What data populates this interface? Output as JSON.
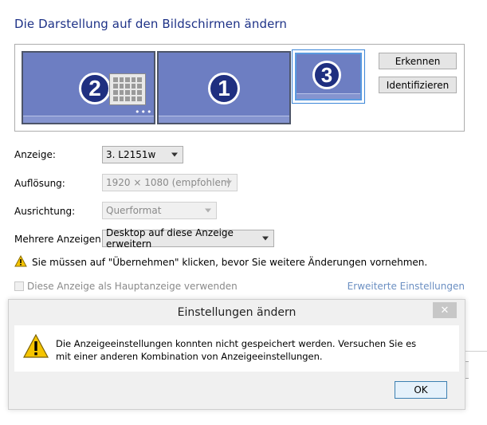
{
  "page": {
    "title": "Die Darstellung auf den Bildschirmen ändern"
  },
  "monitors": [
    {
      "number": "2"
    },
    {
      "number": "1"
    },
    {
      "number": "3",
      "selected": true
    }
  ],
  "monitor_overlay": {
    "dots": "•••"
  },
  "side_buttons": {
    "detect_label": "Erkennen",
    "identify_label": "Identifizieren"
  },
  "settings": {
    "display": {
      "label": "Anzeige:",
      "value": "3. L2151w"
    },
    "resolution": {
      "label": "Auflösung:",
      "value": "1920 × 1080 (empfohlen)"
    },
    "orientation": {
      "label": "Ausrichtung:",
      "value": "Querformat"
    },
    "multiple": {
      "label": "Mehrere Anzeigen:",
      "value": "Desktop auf diese Anzeige erweitern"
    }
  },
  "warning": {
    "text": "Sie müssen auf \"Übernehmen\" klicken, bevor Sie weitere Änderungen vornehmen."
  },
  "primary_checkbox": {
    "label": "Diese Anzeige als Hauptanzeige verwenden",
    "checked": false
  },
  "advanced_link": "Erweiterte Einstellungen",
  "dialog": {
    "title": "Einstellungen ändern",
    "close": "✕",
    "message": "Die Anzeigeeinstellungen konnten nicht gespeichert werden. Versuchen Sie es mit einer anderen Kombination von Anzeigeeinstellungen.",
    "ok_label": "OK"
  },
  "colors": {
    "title": "#1e3287",
    "monitor_fill": "#6d7ec2",
    "badge": "#1f2f80",
    "link": "#6b8fc2",
    "warning": "#f5c400"
  }
}
